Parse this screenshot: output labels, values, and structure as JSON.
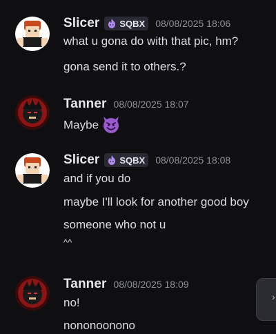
{
  "messages": [
    {
      "author": "Slicer",
      "tag": "SQBX",
      "timestamp": "08/08/2025 18:06",
      "lines": [
        "what u gona do with that pic, hm?",
        "gona send it to others.?"
      ]
    },
    {
      "author": "Tanner",
      "timestamp": "08/08/2025 18:07",
      "lines": [
        "Maybe"
      ],
      "emoji": "smiling-imp-emoji"
    },
    {
      "author": "Slicer",
      "tag": "SQBX",
      "timestamp": "08/08/2025 18:08",
      "lines": [
        "and if you do",
        "maybe I'll look for another good boy",
        "someone who not u",
        "^^"
      ]
    },
    {
      "author": "Tanner",
      "timestamp": "08/08/2025 18:09",
      "lines": [
        "no!",
        "nononoonono"
      ]
    }
  ],
  "side_button": {
    "icon": "chevron-icon",
    "glyph": "›"
  },
  "colors": {
    "background": "#0f0f12",
    "username": "#e8e8ec",
    "message_text": "#dcdde1",
    "timestamp": "#8f9199",
    "tag_background": "#2a2a34",
    "tag_icon": "#b18cf0"
  }
}
